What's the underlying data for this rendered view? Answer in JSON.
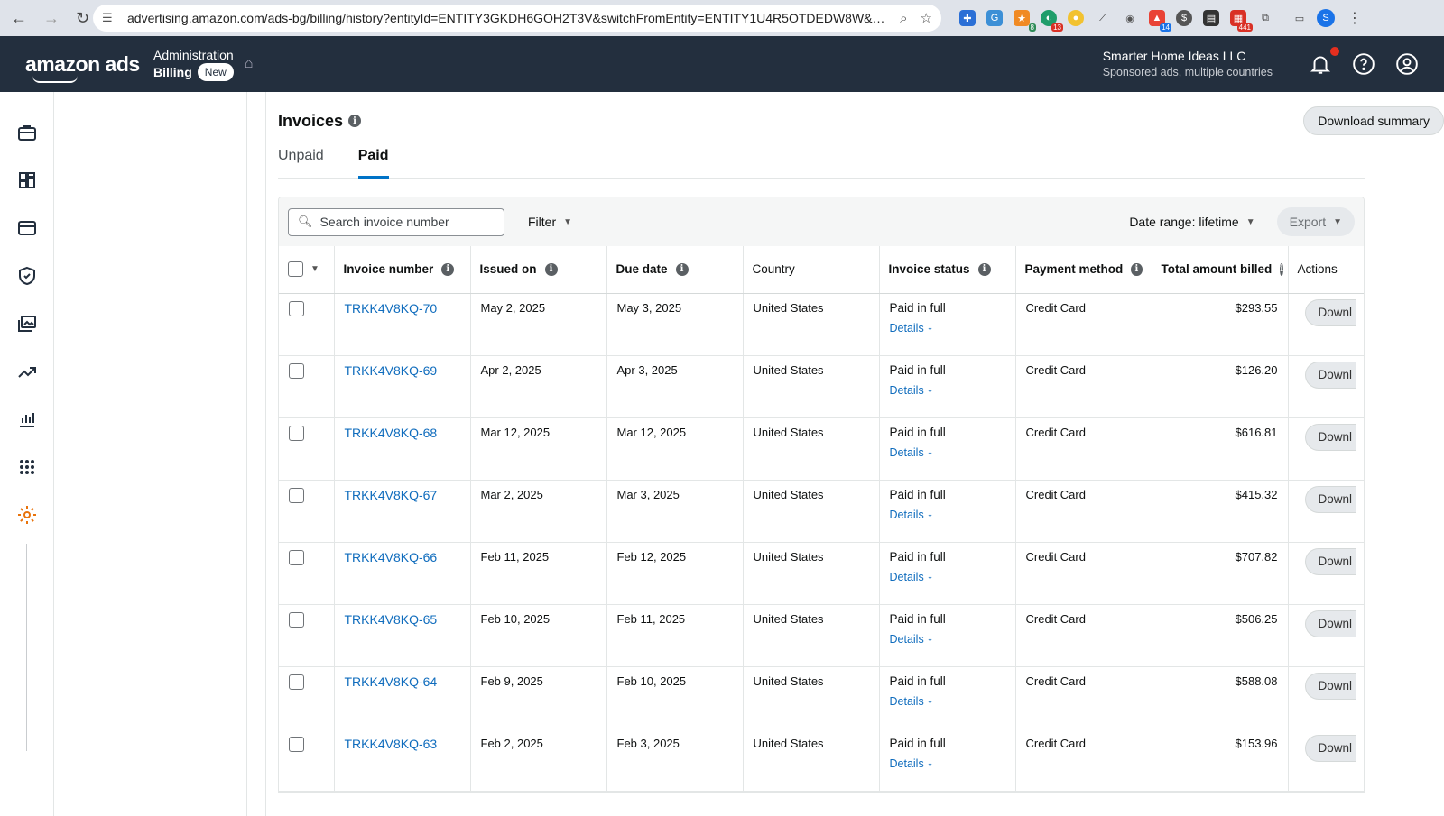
{
  "browser": {
    "url": "advertising.amazon.com/ads-bg/billing/history?entityId=ENTITY3GKDH6GOH2T3V&switchFromEntity=ENTITY1U4R5OTDEDW8W&in...",
    "ext_badges": [
      "8",
      "13",
      "14",
      "441"
    ],
    "profile_initial": "S"
  },
  "header": {
    "logo": "amazon ads",
    "context_top": "Administration",
    "context_bottom": "Billing",
    "new_badge": "New",
    "account_name": "Smarter Home Ideas LLC",
    "account_sub": "Sponsored ads, multiple countries"
  },
  "page": {
    "title": "Invoices",
    "download_summary": "Download summary",
    "tabs": [
      {
        "label": "Unpaid"
      },
      {
        "label": "Paid"
      }
    ],
    "search_placeholder": "Search invoice number",
    "filter": "Filter",
    "date_range": "Date range: lifetime",
    "export": "Export"
  },
  "table": {
    "columns": [
      "Invoice number",
      "Issued on",
      "Due date",
      "Country",
      "Invoice status",
      "Payment method",
      "Total amount billed",
      "Actions"
    ],
    "rows": [
      {
        "invoice": "TRKK4V8KQ-70",
        "issued": "May 2, 2025",
        "due": "May 3, 2025",
        "country": "United States",
        "status": "Paid in full",
        "details": "Details",
        "method": "Credit Card",
        "total": "$293.55",
        "action": "Downl"
      },
      {
        "invoice": "TRKK4V8KQ-69",
        "issued": "Apr 2, 2025",
        "due": "Apr 3, 2025",
        "country": "United States",
        "status": "Paid in full",
        "details": "Details",
        "method": "Credit Card",
        "total": "$126.20",
        "action": "Downl"
      },
      {
        "invoice": "TRKK4V8KQ-68",
        "issued": "Mar 12, 2025",
        "due": "Mar 12, 2025",
        "country": "United States",
        "status": "Paid in full",
        "details": "Details",
        "method": "Credit Card",
        "total": "$616.81",
        "action": "Downl"
      },
      {
        "invoice": "TRKK4V8KQ-67",
        "issued": "Mar 2, 2025",
        "due": "Mar 3, 2025",
        "country": "United States",
        "status": "Paid in full",
        "details": "Details",
        "method": "Credit Card",
        "total": "$415.32",
        "action": "Downl"
      },
      {
        "invoice": "TRKK4V8KQ-66",
        "issued": "Feb 11, 2025",
        "due": "Feb 12, 2025",
        "country": "United States",
        "status": "Paid in full",
        "details": "Details",
        "method": "Credit Card",
        "total": "$707.82",
        "action": "Downl"
      },
      {
        "invoice": "TRKK4V8KQ-65",
        "issued": "Feb 10, 2025",
        "due": "Feb 11, 2025",
        "country": "United States",
        "status": "Paid in full",
        "details": "Details",
        "method": "Credit Card",
        "total": "$506.25",
        "action": "Downl"
      },
      {
        "invoice": "TRKK4V8KQ-64",
        "issued": "Feb 9, 2025",
        "due": "Feb 10, 2025",
        "country": "United States",
        "status": "Paid in full",
        "details": "Details",
        "method": "Credit Card",
        "total": "$588.08",
        "action": "Downl"
      },
      {
        "invoice": "TRKK4V8KQ-63",
        "issued": "Feb 2, 2025",
        "due": "Feb 3, 2025",
        "country": "United States",
        "status": "Paid in full",
        "details": "Details",
        "method": "Credit Card",
        "total": "$153.96",
        "action": "Downl"
      }
    ]
  },
  "colors": {
    "header_bg": "#232f3e",
    "link": "#0f6cbd",
    "accent_orange": "#ff9900",
    "tab_underline": "#0073c7"
  }
}
